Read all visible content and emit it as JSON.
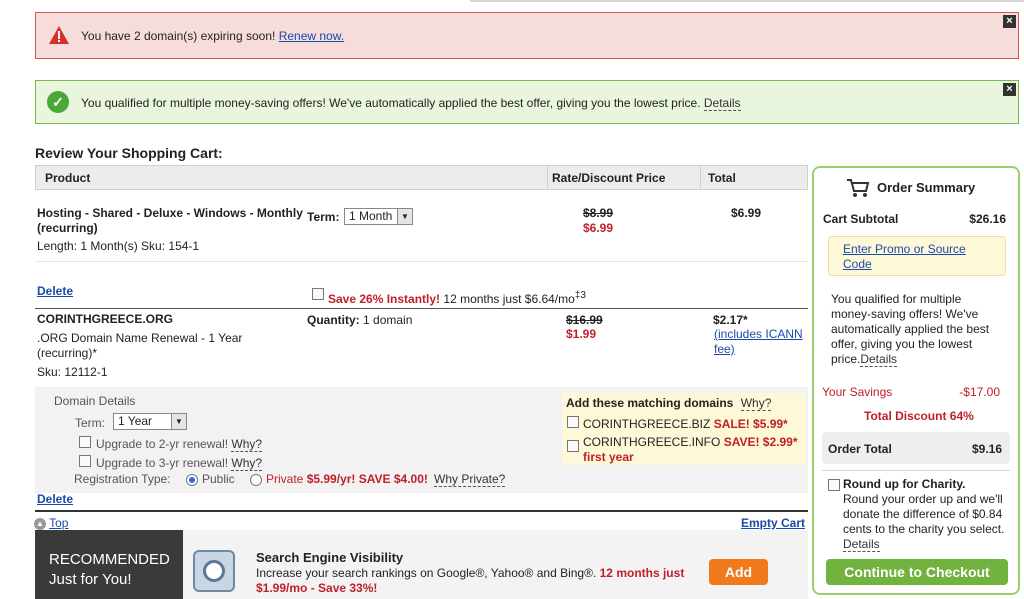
{
  "alerts": {
    "expiring": {
      "text": "You have 2 domain(s) expiring soon!",
      "link": "Renew now."
    },
    "offers": {
      "text": "You qualified for multiple money-saving offers! We've automatically applied the best offer, giving you the lowest price.",
      "link": "Details"
    },
    "close_glyph": "×"
  },
  "cart": {
    "title": "Review Your Shopping Cart:",
    "columns": {
      "product": "Product",
      "rate": "Rate/Discount Price",
      "total": "Total"
    },
    "hosting": {
      "name": "Hosting - Shared - Deluxe - Windows - Monthly",
      "name2": "(recurring)",
      "meta": "Length: 1 Month(s) Sku: 154-1",
      "term_label": "Term:",
      "term_value": "1 Month",
      "old_price": "$8.99",
      "new_price": "$6.99",
      "total": "$6.99",
      "delete": "Delete",
      "upsell_save": "Save 26% Instantly!",
      "upsell_text": " 12 months just $6.64/mo",
      "upsell_sup": "‡3"
    },
    "domain": {
      "name": "CORINTHGREECE.ORG",
      "desc1": ".ORG Domain Name Renewal - 1 Year",
      "desc2": "(recurring)*",
      "sku": "Sku: 12112-1",
      "qty_label": "Quantity:",
      "qty_value": " 1 domain",
      "old_price": "$16.99",
      "new_price": "$1.99",
      "total": "$2.17*",
      "icann1": "(includes ICANN",
      "icann2": "fee)"
    },
    "details": {
      "title": "Domain Details",
      "term_label": "Term:",
      "term_value": "1 Year",
      "upgrade2": "Upgrade to 2-yr renewal!",
      "upgrade3": "Upgrade to 3-yr renewal!",
      "why": "Why?",
      "reg_label": "Registration Type:",
      "public": "Public",
      "private": "Private",
      "private_price": "$5.99/yr! SAVE $4.00!",
      "why_private": "Why Private?",
      "delete": "Delete"
    },
    "matching": {
      "title": "Add these matching domains",
      "why": "Why?",
      "items": [
        {
          "name": "CORINTHGREECE.BIZ",
          "sale": "SALE! $5.99*"
        },
        {
          "name": "CORINTHGREECE.INFO",
          "sale": "SAVE! $2.99*",
          "sale2": "first year"
        }
      ]
    },
    "top_link": "Top",
    "empty_cart": "Empty Cart"
  },
  "summary": {
    "title": "Order Summary",
    "subtotal_label": "Cart Subtotal",
    "subtotal_value": "$26.16",
    "promo1": "Enter Promo or Source",
    "promo2": "Code",
    "offer_lines": [
      "You qualified for multiple",
      "money-saving offers! We've",
      "automatically applied the best",
      "offer, giving you the lowest"
    ],
    "offer_last": "price.",
    "offer_link": "Details",
    "savings_label": "Your Savings",
    "savings_value": "-$17.00",
    "discount": "Total Discount 64%",
    "total_label": "Order Total",
    "total_value": "$9.16",
    "charity_title": "Round up for Charity.",
    "charity_lines": [
      "Round your order up and we'll",
      "donate the difference of $0.84",
      "cents to the charity you select."
    ],
    "charity_link": "Details",
    "checkout": "Continue to Checkout"
  },
  "recommended": {
    "line1": "RECOMMENDED",
    "line2": "Just for You!",
    "product_title": "Search Engine Visibility",
    "product_desc": "Increase your search rankings on Google®, Yahoo® and Bing®.",
    "promo1": " 12 months just",
    "promo2": "$1.99/mo - Save 33%!",
    "add": "Add"
  }
}
